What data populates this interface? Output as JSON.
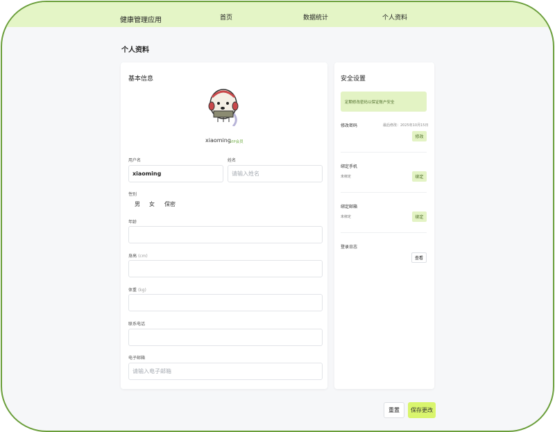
{
  "app": {
    "title": "健康管理应用"
  },
  "nav": {
    "items": [
      "首页",
      "数据统计",
      "个人资料"
    ],
    "active": "个人资料"
  },
  "page": {
    "title": "个人资料"
  },
  "basic": {
    "title": "基本信息",
    "username_display": "xiaoming",
    "vip_badge": "VIP会员",
    "fields": {
      "username": {
        "label": "用户名",
        "value": "xiaoming"
      },
      "name": {
        "label": "姓名",
        "placeholder": "请输入姓名"
      },
      "gender": {
        "label": "性别",
        "options": [
          "男",
          "女",
          "保密"
        ]
      },
      "age": {
        "label": "年龄"
      },
      "height": {
        "label": "身高",
        "unit": "(cm)"
      },
      "weight": {
        "label": "体重",
        "unit": "(kg)"
      },
      "phone": {
        "label": "联系电话"
      },
      "email": {
        "label": "电子邮箱",
        "placeholder": "请输入电子邮箱"
      }
    }
  },
  "security": {
    "title": "安全设置",
    "notice": "定期修改密码以保证账户安全",
    "password": {
      "label": "修改密码",
      "meta": "最后修改：2025年10月15日",
      "button": "修改"
    },
    "phone": {
      "label": "绑定手机",
      "status": "未绑定",
      "button": "绑定"
    },
    "email": {
      "label": "绑定邮箱",
      "status": "未绑定",
      "button": "绑定"
    },
    "log": {
      "label": "登录日志",
      "button": "查看"
    }
  },
  "actions": {
    "reset": "重置",
    "save": "保存更改"
  },
  "colors": {
    "accent": "#d9f56d",
    "topbar": "#e4f5c6",
    "frame_border": "#6a9e3a",
    "vip": "#79b24e"
  }
}
